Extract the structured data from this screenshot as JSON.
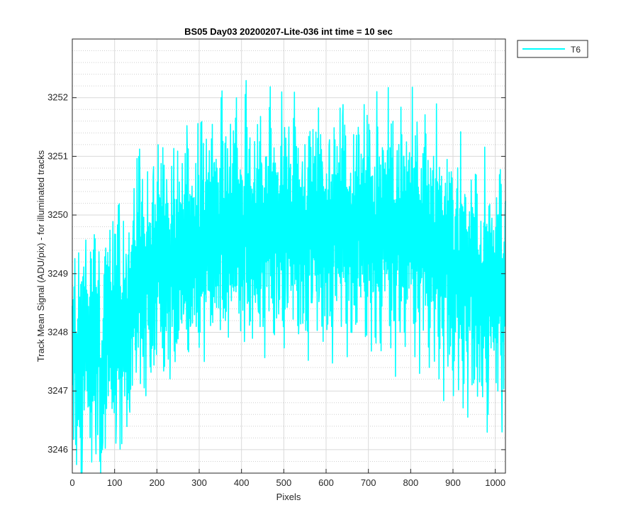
{
  "chart_data": {
    "type": "line",
    "title": "BS05 Day03 20200207-Lite-036 int time = 10 sec",
    "xlabel": "Pixels",
    "ylabel": "Track Mean Signal (ADU/pix) - for illuminated tracks",
    "xlim": [
      0,
      1024
    ],
    "ylim": [
      3245.6,
      3253.0
    ],
    "xticks": [
      0,
      100,
      200,
      300,
      400,
      500,
      600,
      700,
      800,
      900,
      1000
    ],
    "yticks": [
      3246,
      3247,
      3248,
      3249,
      3250,
      3251,
      3252
    ],
    "grid": true,
    "minor_grid_y": true,
    "legend_position": "outside-top-right",
    "colors": {
      "series": "#00ffff",
      "axis": "#262626",
      "grid": "#d9d9d9"
    },
    "series": [
      {
        "name": "T6",
        "color": "#00ffff",
        "sample_step": 8,
        "x_start": 0,
        "values": [
          3248.0,
          3247.5,
          3247.2,
          3247.8,
          3248.0,
          3247.3,
          3247.8,
          3248.2,
          3247.0,
          3247.6,
          3248.2,
          3248.0,
          3247.5,
          3248.4,
          3248.1,
          3248.3,
          3248.0,
          3248.5,
          3248.6,
          3248.8,
          3249.0,
          3248.9,
          3249.2,
          3249.0,
          3249.1,
          3249.3,
          3249.0,
          3249.2,
          3249.1,
          3249.4,
          3249.2,
          3249.3,
          3249.0,
          3249.5,
          3249.3,
          3249.4,
          3249.6,
          3249.4,
          3249.8,
          3249.5,
          3249.7,
          3249.6,
          3249.9,
          3249.7,
          3249.8,
          3249.6,
          3249.9,
          3249.7,
          3250.0,
          3249.8,
          3249.6,
          3249.9,
          3249.7,
          3249.8,
          3249.5,
          3249.7,
          3249.6,
          3249.9,
          3249.8,
          3249.7,
          3250.0,
          3249.8,
          3249.6,
          3249.9,
          3249.7,
          3249.8,
          3249.9,
          3249.7,
          3249.8,
          3249.6,
          3249.9,
          3249.8,
          3249.7,
          3249.9,
          3249.6,
          3249.8,
          3249.7,
          3249.9,
          3249.7,
          3249.8,
          3249.9,
          3249.6,
          3249.8,
          3249.7,
          3249.9,
          3249.8,
          3249.6,
          3249.8,
          3249.9,
          3249.7,
          3249.8,
          3249.6,
          3249.9,
          3249.7,
          3249.8,
          3249.6,
          3249.9,
          3249.7,
          3249.8,
          3249.9,
          3249.6,
          3249.8,
          3249.7,
          3249.6,
          3249.8,
          3249.5,
          3249.6,
          3249.3,
          3249.5,
          3249.2,
          3249.4,
          3249.1,
          3249.0,
          3249.2,
          3248.9,
          3249.0,
          3248.8,
          3249.0,
          3248.7,
          3248.9,
          3248.6,
          3248.8,
          3248.5,
          3248.7,
          3248.8,
          3248.6,
          3248.9,
          3248.7,
          3248.8
        ],
        "noise": [
          0.9,
          -1.1,
          1.3,
          -0.7,
          1.6,
          -1.4,
          0.6,
          -0.9,
          1.8,
          -1.7,
          1.1,
          -0.6,
          1.4,
          -1.9,
          0.8,
          -1.2,
          2.2,
          -1.0,
          1.5,
          -1.6,
          0.7,
          -2.0,
          1.9,
          -0.8,
          1.2,
          -1.5,
          1.7,
          -1.1,
          0.9,
          -1.8,
          2.4,
          -1.3,
          1.0,
          -2.3,
          1.4,
          -0.9,
          1.8,
          -1.6,
          0.6,
          -1.4,
          2.0,
          -1.0,
          1.3,
          -2.1,
          1.7,
          -0.7,
          1.1,
          -1.9,
          2.6,
          -1.2,
          0.8,
          -1.7,
          1.6,
          -2.4,
          1.2,
          -1.0,
          1.9,
          -1.5,
          0.7,
          -1.8
        ]
      }
    ]
  }
}
